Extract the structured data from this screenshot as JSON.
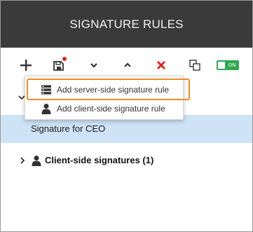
{
  "header": {
    "title": "SIGNATURE RULES"
  },
  "toolbar": {
    "buttons": [
      {
        "name": "add",
        "icon": "plus-icon"
      },
      {
        "name": "save",
        "icon": "save-icon",
        "has_unsaved_indicator": true
      },
      {
        "name": "move-down",
        "icon": "chevron-down-icon"
      },
      {
        "name": "move-up",
        "icon": "chevron-up-icon"
      },
      {
        "name": "delete",
        "icon": "close-icon"
      },
      {
        "name": "duplicate",
        "icon": "copy-icon"
      }
    ],
    "toggle": {
      "label": "ON",
      "state": "on",
      "color": "#2fa84f"
    }
  },
  "add_menu": {
    "items": [
      {
        "label": "Add server-side signature rule",
        "icon": "server-icon",
        "highlighted": true
      },
      {
        "label": "Add client-side signature rule",
        "icon": "user-icon",
        "highlighted": false
      }
    ],
    "highlight_color": "#f08a24"
  },
  "tree": {
    "selected_item": {
      "label": "Signature for CEO"
    },
    "client_group": {
      "label": "Client-side signatures (1)",
      "icon": "user-icon"
    }
  },
  "colors": {
    "header_bg": "#3a3a3a",
    "selection_bg": "#cfe3f6",
    "delete_red": "#e0241b",
    "indicator_red": "#e0241b"
  }
}
